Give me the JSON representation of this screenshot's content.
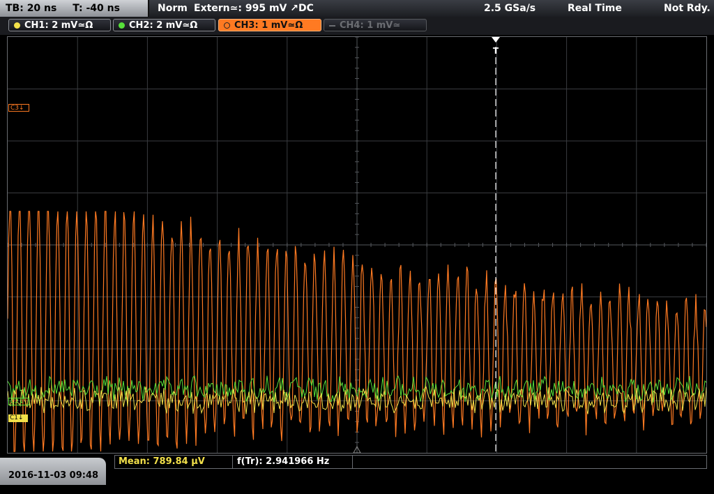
{
  "header": {
    "timebase": "TB: 20 ns",
    "trigger_time": "T: -40 ns",
    "mode": "Norm",
    "trigger": "Extern≃: 995 mV ↗DC",
    "sample_rate": "2.5 GSa/s",
    "acq_mode": "Real Time",
    "status": "Not Rdy."
  },
  "channels": [
    {
      "label": "CH1: 2 mV≃Ω",
      "color": "#f2e04a",
      "state": "on"
    },
    {
      "label": "CH2: 2 mV≃Ω",
      "color": "#57e03a",
      "state": "on"
    },
    {
      "label": "CH3: 1 mV≃Ω",
      "color": "#ff7a22",
      "state": "active"
    },
    {
      "label": "CH4: 1 mV≃",
      "color": "#6b6d72",
      "state": "off"
    }
  ],
  "markers": {
    "c3": "C3↓",
    "c2": "C2↓",
    "c1": "C1↓",
    "trigger": "T"
  },
  "footer": {
    "datetime": "2016-11-03 09:48",
    "measurement1": "Mean: 789.84 µV",
    "measurement2": "f(Tr): 2.941966 Hz"
  },
  "colors": {
    "ch1": "#f2e04a",
    "ch2": "#57e03a",
    "ch3": "#ff7a22",
    "grid": "#3a3c40"
  }
}
